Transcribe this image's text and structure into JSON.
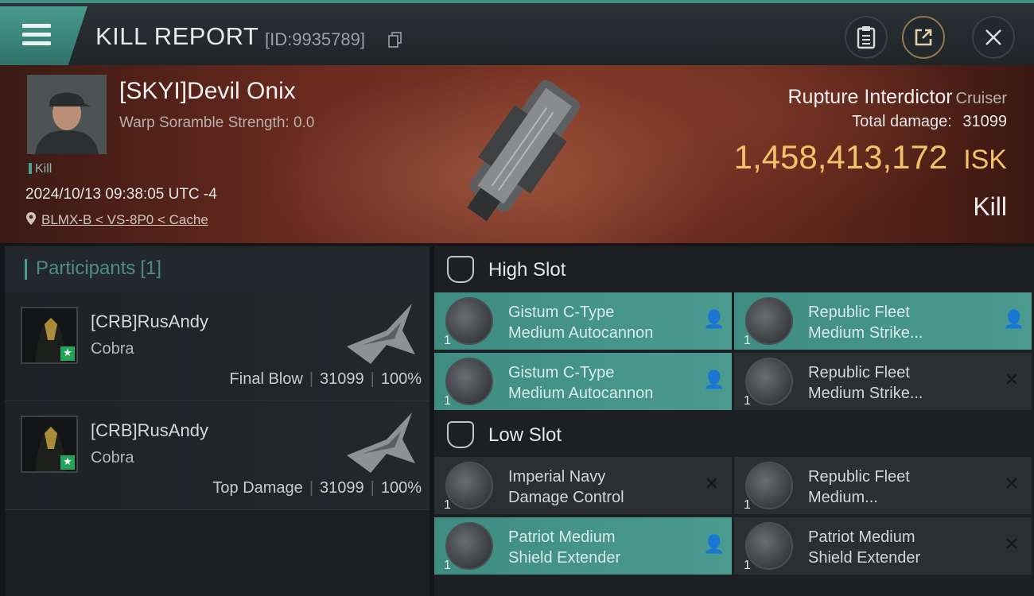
{
  "header": {
    "title": "KILL REPORT",
    "report_id": "[ID:9935789]"
  },
  "victim": {
    "name": "[SKYI]Devil Onix",
    "scramble": "Warp Soramble Strength: 0.0",
    "kill_tag": "Kill",
    "date": "2024/10/13 09:38:05 UTC -4",
    "location": "BLMX-B < VS-8P0 < Cache",
    "ship_name": "Rupture Interdictor",
    "ship_class": "Cruiser",
    "total_damage_label": "Total damage:",
    "total_damage": "31099",
    "isk_value": "1,458,413,172",
    "isk_unit": "ISK",
    "result": "Kill"
  },
  "participants": {
    "title": "Participants",
    "count": "[1]",
    "rows": [
      {
        "name": "[CRB]RusAndy",
        "ship": "Cobra",
        "role": "Final Blow",
        "damage": "31099",
        "percent": "100%"
      },
      {
        "name": "[CRB]RusAndy",
        "ship": "Cobra",
        "role": "Top Damage",
        "damage": "31099",
        "percent": "100%"
      }
    ]
  },
  "fitting": {
    "high_slot_label": "High Slot",
    "low_slot_label": "Low Slot",
    "high": [
      {
        "line1": "Gistum C-Type",
        "line2": "Medium Autocannon",
        "qty": "1",
        "state": "destroyed"
      },
      {
        "line1": "Republic Fleet",
        "line2": "Medium Strike...",
        "qty": "1",
        "state": "destroyed"
      },
      {
        "line1": "Gistum C-Type",
        "line2": "Medium Autocannon",
        "qty": "1",
        "state": "destroyed"
      },
      {
        "line1": "Republic Fleet",
        "line2": "Medium Strike...",
        "qty": "1",
        "state": "dropped"
      }
    ],
    "low": [
      {
        "line1": "Imperial Navy",
        "line2": "Damage Control",
        "qty": "1",
        "state": "dropped"
      },
      {
        "line1": "Republic Fleet",
        "line2": "Medium...",
        "qty": "1",
        "state": "dropped"
      },
      {
        "line1": "Patriot Medium",
        "line2": "Shield Extender",
        "qty": "1",
        "state": "destroyed"
      },
      {
        "line1": "Patriot Medium",
        "line2": "Shield Extender",
        "qty": "1",
        "state": "dropped"
      }
    ]
  },
  "colors": {
    "accent": "#3e8c82",
    "isk": "#f1c26a",
    "hero_bg": "#6a2a1e"
  },
  "icons": {
    "menu": "hamburger-icon",
    "copy": "copy-icon",
    "clipboard": "clipboard-icon",
    "share": "share-icon",
    "close": "close-icon",
    "location": "location-pin-icon",
    "destroyed": "person-icon",
    "dropped": "x-icon"
  }
}
